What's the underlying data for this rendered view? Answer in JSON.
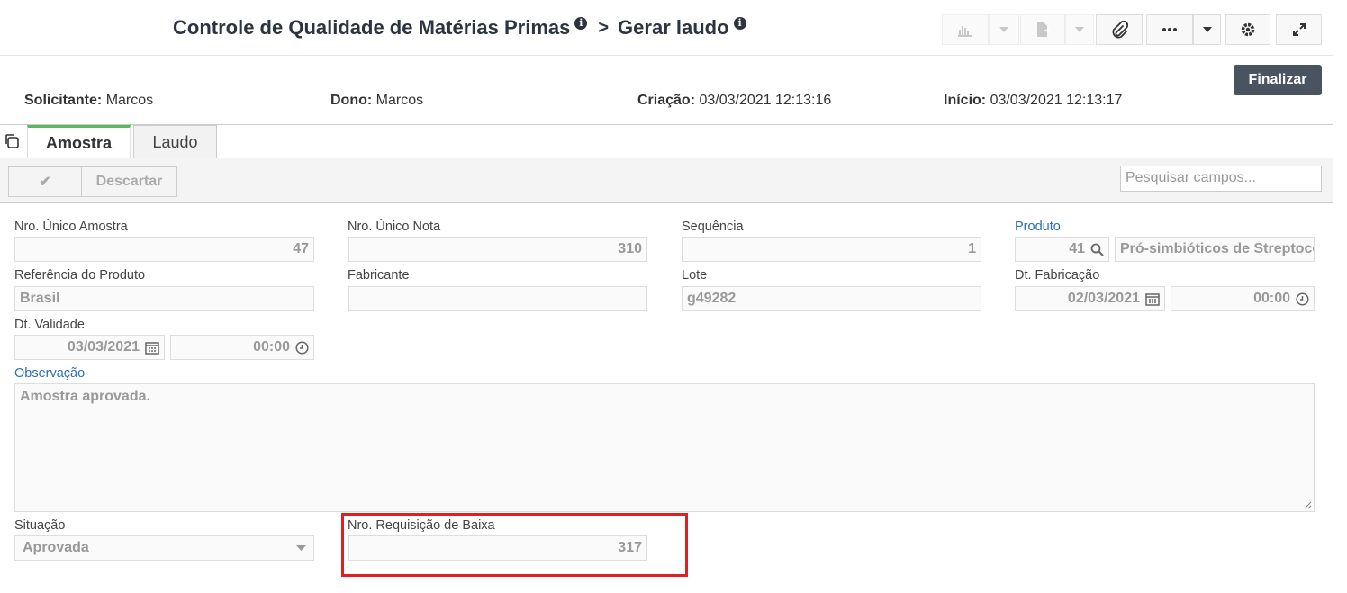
{
  "header": {
    "title": "Controle de Qualidade de Matérias Primas",
    "info_glyph": "i",
    "separator": ">",
    "subtitle": "Gerar laudo",
    "finalize_label": "Finalizar"
  },
  "meta": {
    "solicitante_label": "Solicitante:",
    "solicitante_value": "Marcos",
    "dono_label": "Dono:",
    "dono_value": "Marcos",
    "criacao_label": "Criação:",
    "criacao_value": "03/03/2021 12:13:16",
    "inicio_label": "Início:",
    "inicio_value": "03/03/2021 12:13:17"
  },
  "tabs": [
    {
      "label": "Amostra"
    },
    {
      "label": "Laudo"
    }
  ],
  "toolbar": {
    "confirm_glyph": "✔",
    "discard_label": "Descartar",
    "search_placeholder": "Pesquisar campos..."
  },
  "form": {
    "nro_unico_amostra": {
      "label": "Nro. Único Amostra",
      "value": "47"
    },
    "nro_unico_nota": {
      "label": "Nro. Único Nota",
      "value": "310"
    },
    "sequencia": {
      "label": "Sequência",
      "value": "1"
    },
    "produto": {
      "label": "Produto",
      "code": "41",
      "name": "Pró-simbióticos de Streptococcus"
    },
    "referencia_produto": {
      "label": "Referência do Produto",
      "value": "Brasil"
    },
    "fabricante": {
      "label": "Fabricante",
      "value": ""
    },
    "lote": {
      "label": "Lote",
      "value": "g49282"
    },
    "dt_fabricacao": {
      "label": "Dt. Fabricação",
      "date": "02/03/2021",
      "time": "00:00"
    },
    "dt_validade": {
      "label": "Dt. Validade",
      "date": "03/03/2021",
      "time": "00:00"
    },
    "observacao": {
      "label": "Observação",
      "value": "Amostra aprovada."
    },
    "situacao": {
      "label": "Situação",
      "value": "Aprovada"
    },
    "nro_requisicao_baixa": {
      "label": "Nro. Requisição de Baixa",
      "value": "317"
    }
  },
  "colors": {
    "accent": "#5cb85c",
    "link": "#2a6ebb",
    "highlight": "#e02020",
    "finalize_bg": "#4a5360"
  }
}
